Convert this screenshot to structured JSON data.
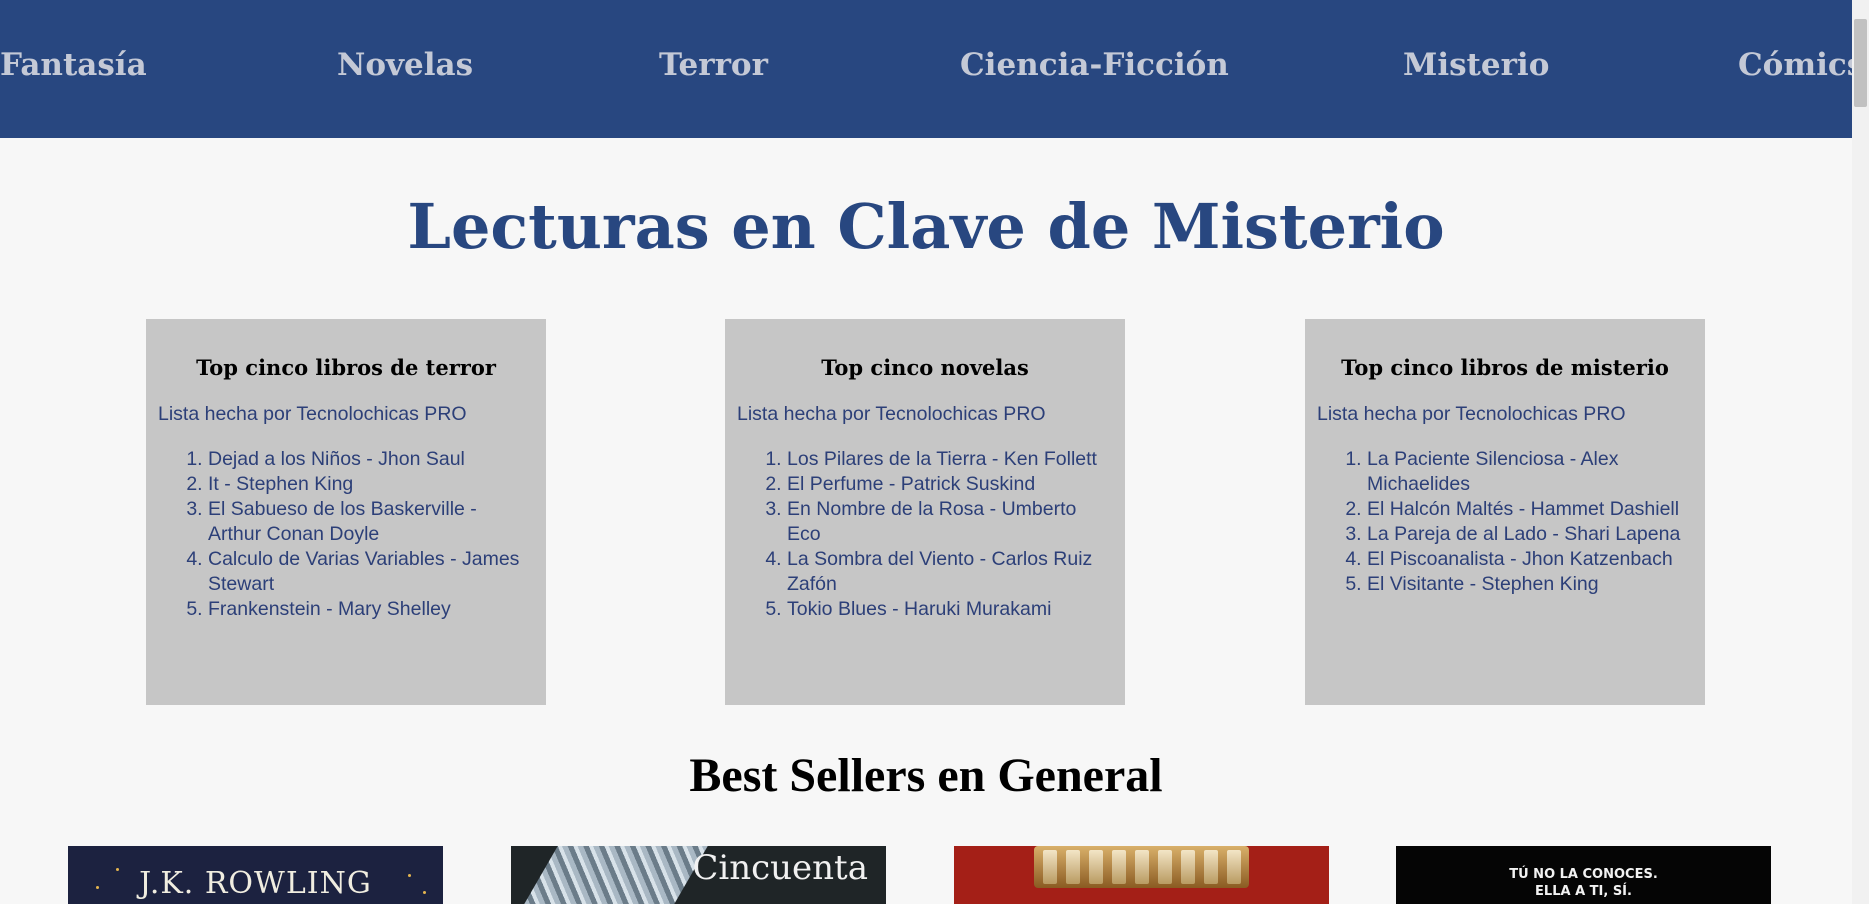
{
  "nav": {
    "items": [
      "Fantasía",
      "Novelas",
      "Terror",
      "Ciencia-Ficción",
      "Misterio",
      "Cómics"
    ]
  },
  "page_title": "Lecturas en Clave de Misterio",
  "cards": [
    {
      "title": "Top cinco libros de terror",
      "byline": "Lista hecha por Tecnolochicas PRO",
      "items": [
        "Dejad a los Niños - Jhon Saul",
        "It - Stephen King",
        "El Sabueso de los Baskerville - Arthur Conan Doyle",
        "Calculo de Varias Variables - James Stewart",
        "Frankenstein - Mary Shelley"
      ]
    },
    {
      "title": "Top cinco novelas",
      "byline": "Lista hecha por Tecnolochicas PRO",
      "items": [
        "Los Pilares de la Tierra - Ken Follett",
        "El Perfume - Patrick Suskind",
        "En Nombre de la Rosa - Umberto Eco",
        "La Sombra del Viento - Carlos Ruiz Zafón",
        "Tokio Blues - Haruki Murakami"
      ]
    },
    {
      "title": "Top cinco libros de misterio",
      "byline": "Lista hecha por Tecnolochicas PRO",
      "items": [
        "La Paciente Silenciosa - Alex Michaelides",
        "El Halcón Maltés - Hammet Dashiell",
        "La Pareja de al Lado - Shari Lapena",
        "El Piscoanalista - Jhon Katzenbach",
        "El Visitante - Stephen King"
      ]
    }
  ],
  "best_sellers": {
    "title": "Best Sellers en General",
    "covers": [
      {
        "text": "J.K. ROWLING"
      },
      {
        "text": "Cincuenta"
      },
      {
        "text": ""
      },
      {
        "text": "TÚ NO LA CONOCES.",
        "text2": "ELLA A TI, SÍ."
      }
    ]
  },
  "colors": {
    "nav_bg": "#284780",
    "nav_text": "#c4c9d6",
    "title": "#284780",
    "card_bg": "#c6c6c6",
    "list_text": "#2c3f78",
    "page_bg": "#f7f7f7"
  }
}
